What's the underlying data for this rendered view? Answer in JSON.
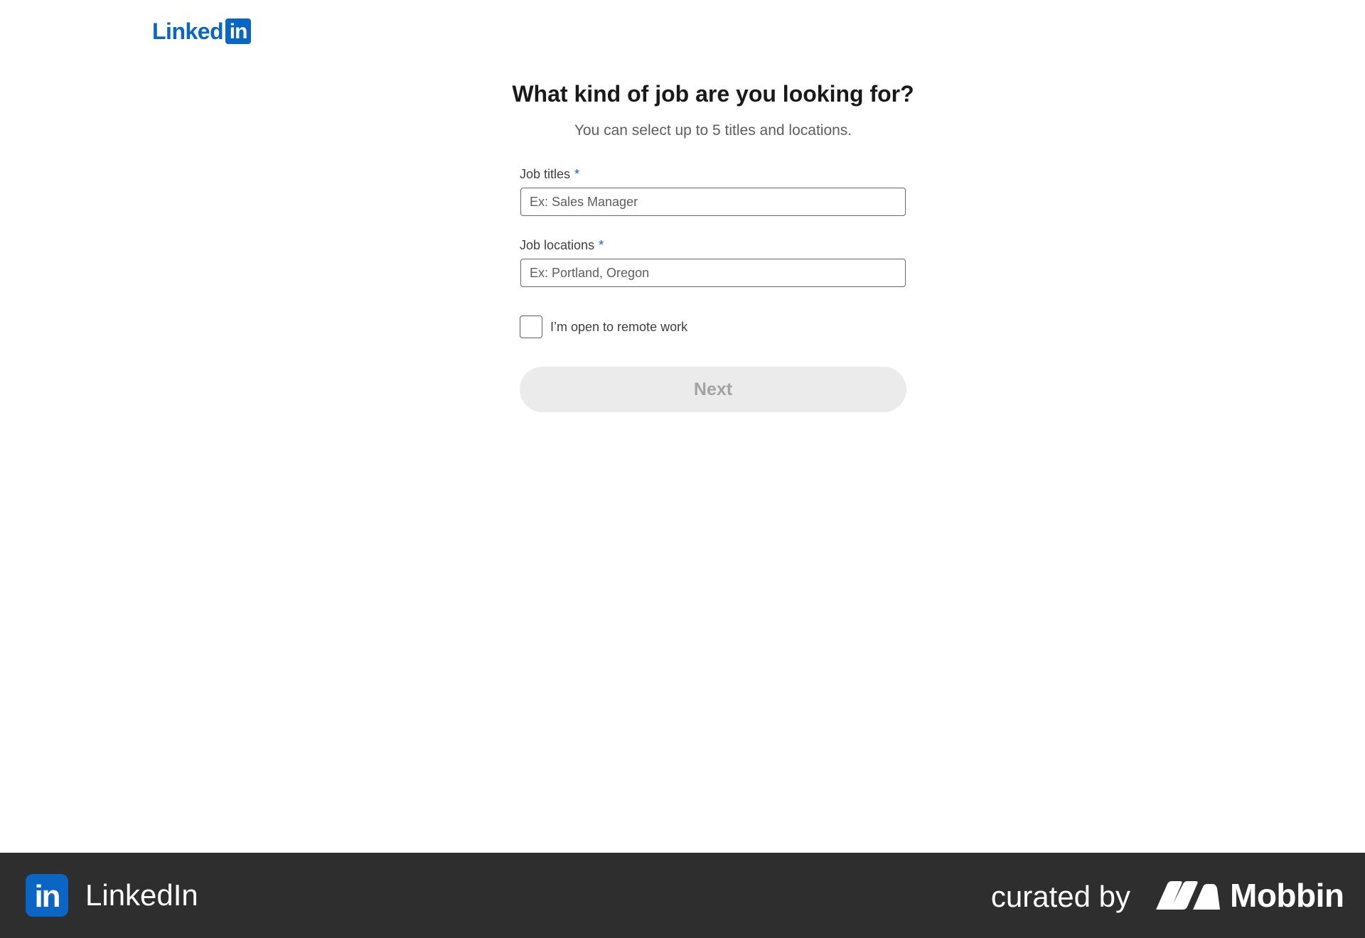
{
  "header": {
    "logo_word": "Linked",
    "logo_box": "in"
  },
  "form": {
    "title": "What kind of job are you looking for?",
    "subtitle": "You can select up to 5 titles and locations.",
    "job_titles": {
      "label": "Job titles",
      "required_mark": "*",
      "placeholder": "Ex: Sales Manager",
      "value": ""
    },
    "job_locations": {
      "label": "Job locations",
      "required_mark": "*",
      "placeholder": "Ex: Portland, Oregon",
      "value": ""
    },
    "remote": {
      "label": "I’m open to remote work",
      "checked": false
    },
    "next_label": "Next"
  },
  "footer": {
    "app_icon": "in",
    "app_name": "LinkedIn",
    "curated_by": "curated by",
    "brand": "Mobbin"
  },
  "colors": {
    "brand_blue": "#0a66c2",
    "footer_bg": "#2e2e2e",
    "disabled_button_bg": "#ebebeb",
    "disabled_button_text": "#a3a3a3"
  },
  "icons": {
    "footer_mark": "mobbin-logo-icon",
    "checkbox": "checkbox-empty-icon"
  }
}
